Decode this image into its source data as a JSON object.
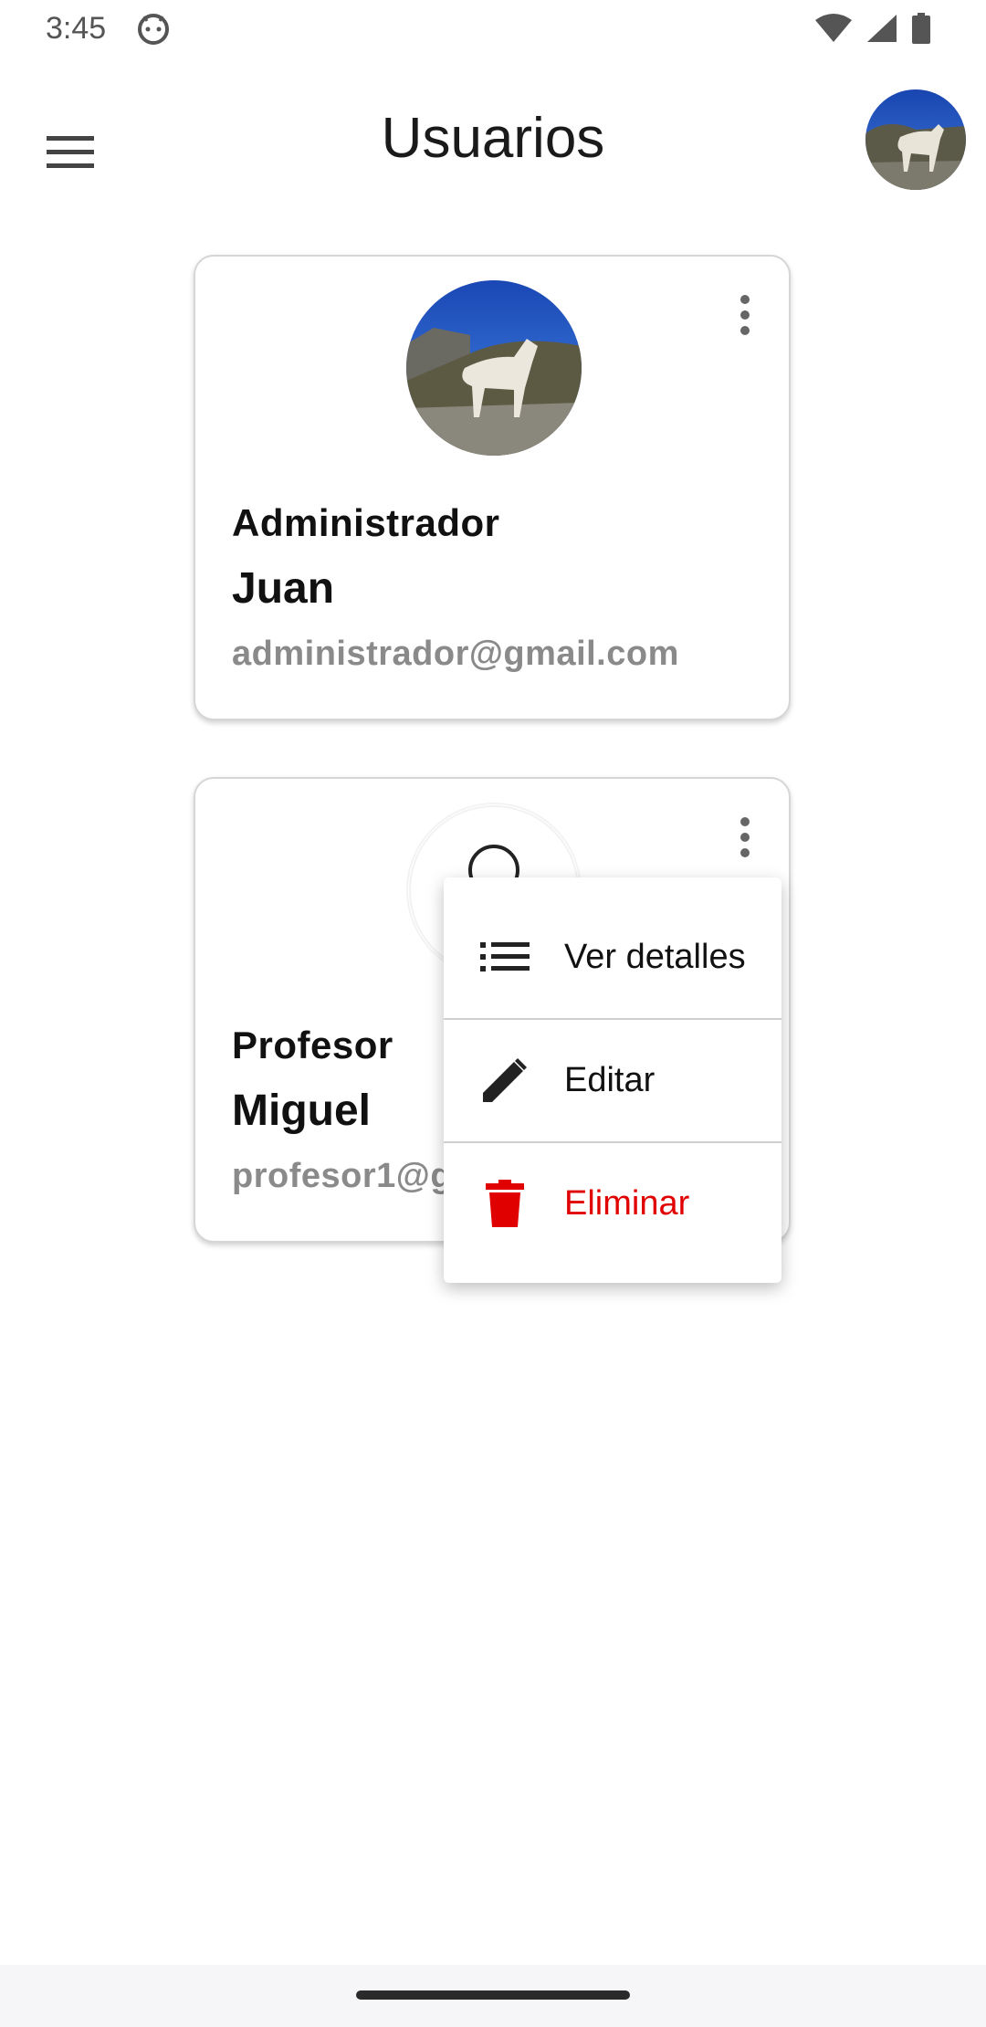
{
  "status_bar": {
    "time": "3:45",
    "icons": [
      "android-icon",
      "wifi-icon",
      "signal-icon",
      "battery-icon"
    ]
  },
  "app_bar": {
    "title": "Usuarios",
    "menu_icon": "hamburger-menu-icon",
    "profile_avatar": "wolf-avatar"
  },
  "users": [
    {
      "role": "Administrador",
      "name": "Juan",
      "email": "administrador@gmail.com",
      "avatar": "wolf-avatar"
    },
    {
      "role": "Profesor",
      "name": "Miguel",
      "email": "profesor1@g",
      "avatar": "loading-avatar"
    }
  ],
  "context_menu": {
    "items": [
      {
        "label": "Ver detalles",
        "icon": "list-icon"
      },
      {
        "label": "Editar",
        "icon": "pencil-icon"
      },
      {
        "label": "Eliminar",
        "icon": "trash-icon"
      }
    ],
    "danger_color": "#e00000"
  }
}
